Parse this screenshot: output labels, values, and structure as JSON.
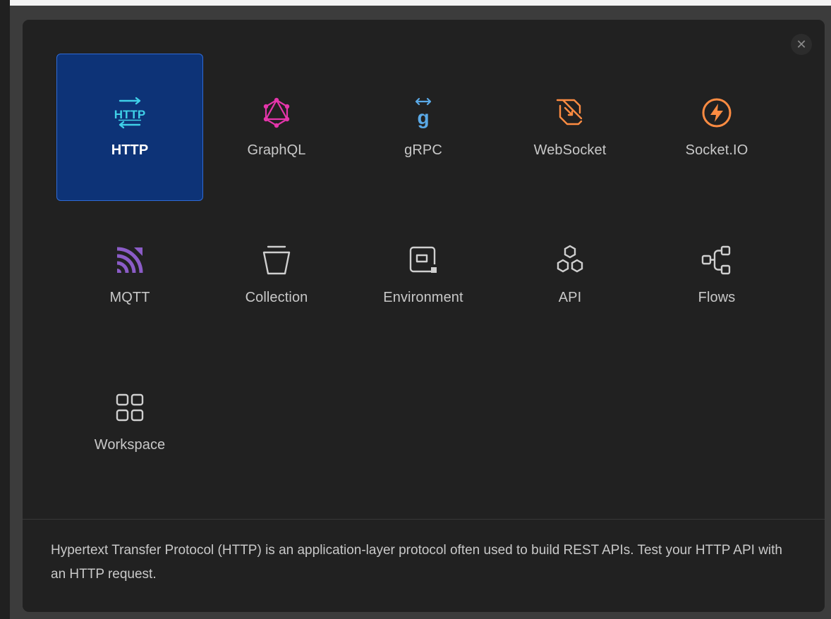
{
  "modal": {
    "close_label": "✕",
    "tiles": [
      {
        "label": "HTTP",
        "icon": "http-icon",
        "active": true
      },
      {
        "label": "GraphQL",
        "icon": "graphql-icon"
      },
      {
        "label": "gRPC",
        "icon": "grpc-icon"
      },
      {
        "label": "WebSocket",
        "icon": "websocket-icon"
      },
      {
        "label": "Socket.IO",
        "icon": "socketio-icon"
      },
      {
        "label": "MQTT",
        "icon": "mqtt-icon"
      },
      {
        "label": "Collection",
        "icon": "collection-icon"
      },
      {
        "label": "Environment",
        "icon": "environment-icon"
      },
      {
        "label": "API",
        "icon": "api-icon"
      },
      {
        "label": "Flows",
        "icon": "flows-icon"
      },
      {
        "label": "Workspace",
        "icon": "workspace-icon"
      }
    ],
    "description": "Hypertext Transfer Protocol (HTTP) is an application-layer protocol often used to build REST APIs. Test your HTTP API with an HTTP request."
  },
  "colors": {
    "accent_tile_bg": "#0d3377",
    "accent_tile_border": "#2f6bd6",
    "http_icon": "#3fd0e8",
    "graphql_icon": "#e535ab",
    "grpc_icon": "#5aa9e6",
    "websocket_icon": "#ff8c42",
    "socketio_icon": "#ff8c42",
    "mqtt_icon": "#8b5cc7",
    "neutral_icon": "#cfcfcf"
  }
}
